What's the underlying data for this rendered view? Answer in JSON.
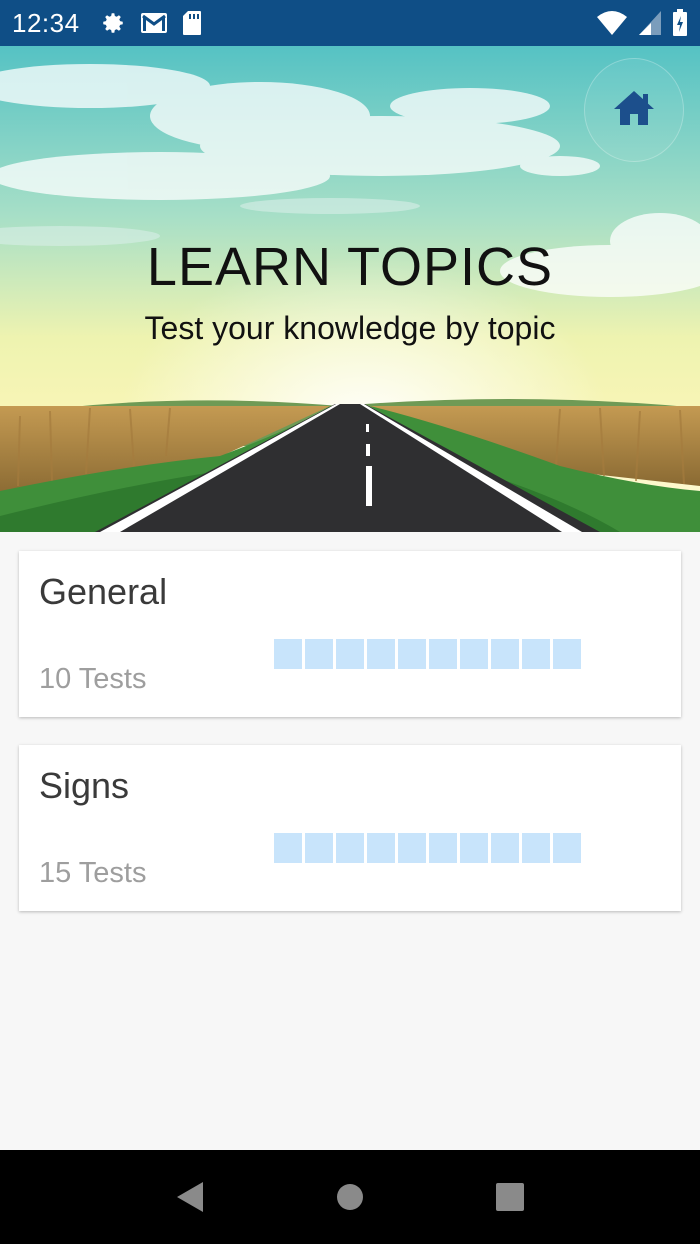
{
  "status_bar": {
    "time": "12:34",
    "left_icons": [
      "gear-icon",
      "gmail-icon",
      "sd-card-icon"
    ],
    "right_icons": [
      "wifi-icon",
      "signal-icon",
      "battery-icon"
    ],
    "bar_color": "#0f4e86"
  },
  "hero": {
    "title": "LEARN TOPICS",
    "subtitle": "Test your knowledge by topic",
    "home_icon": "home-icon",
    "home_color": "#1c4f8c"
  },
  "topics": [
    {
      "name": "General",
      "count_label": "10 Tests",
      "progress_segments": 10,
      "completed": 0
    },
    {
      "name": "Signs",
      "count_label": "15 Tests",
      "progress_segments": 10,
      "completed": 0
    }
  ],
  "colors": {
    "progress_empty": "#c8e4fb",
    "background": "#f7f7f7"
  },
  "nav_bar": {
    "icons": [
      "back-icon",
      "home-circle-icon",
      "recents-icon"
    ]
  }
}
